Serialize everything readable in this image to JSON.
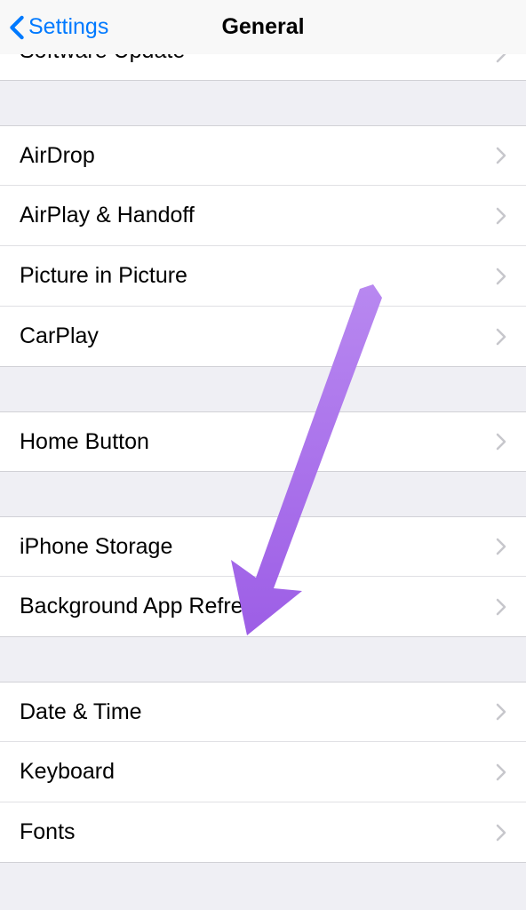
{
  "header": {
    "back_label": "Settings",
    "title": "General"
  },
  "partial_item": {
    "label": "Software Update"
  },
  "groups": [
    {
      "items": [
        {
          "label": "AirDrop"
        },
        {
          "label": "AirPlay & Handoff"
        },
        {
          "label": "Picture in Picture"
        },
        {
          "label": "CarPlay"
        }
      ]
    },
    {
      "items": [
        {
          "label": "Home Button"
        }
      ]
    },
    {
      "items": [
        {
          "label": "iPhone Storage"
        },
        {
          "label": "Background App Refresh"
        }
      ]
    },
    {
      "items": [
        {
          "label": "Date & Time"
        },
        {
          "label": "Keyboard"
        },
        {
          "label": "Fonts"
        }
      ]
    }
  ],
  "annotation": {
    "arrow_color": "#a862ea"
  }
}
